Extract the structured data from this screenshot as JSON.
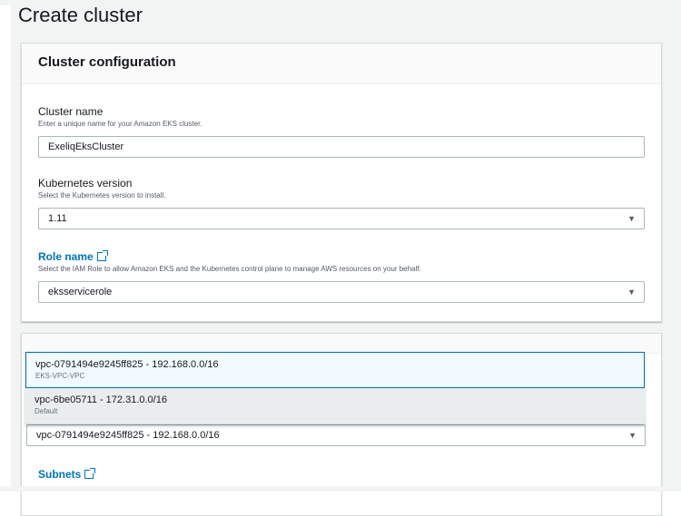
{
  "page": {
    "title": "Create cluster"
  },
  "cluster_config": {
    "header": "Cluster configuration",
    "cluster_name": {
      "label": "Cluster name",
      "description": "Enter a unique name for your Amazon EKS cluster.",
      "value": "ExeliqEksCluster"
    },
    "k8s_version": {
      "label": "Kubernetes version",
      "description": "Select the Kubernetes version to install.",
      "value": "1.11"
    },
    "role_name": {
      "label": "Role name",
      "description": "Select the IAM Role to allow Amazon EKS and the Kubernetes control plane to manage AWS resources on your behalf.",
      "value": "eksservicerole"
    }
  },
  "networking": {
    "vpc_options": [
      {
        "label": "vpc-0791494e9245ff825 - 192.168.0.0/16",
        "sublabel": "EKS-VPC-VPC"
      },
      {
        "label": "vpc-6be05711 - 172.31.0.0/16",
        "sublabel": "Default"
      }
    ],
    "vpc_selected": "vpc-0791494e9245ff825 - 192.168.0.0/16",
    "subnets_label": "Subnets"
  },
  "colors": {
    "link": "#0073bb",
    "page_bg": "#f2f3f3"
  }
}
